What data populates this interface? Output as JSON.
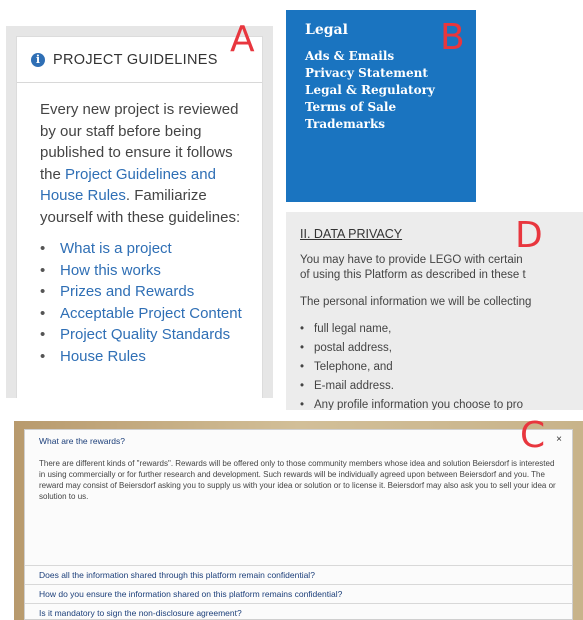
{
  "labels": {
    "a": "A",
    "b": "B",
    "c": "C",
    "d": "D"
  },
  "guidelines": {
    "title": "PROJECT GUIDELINES",
    "text_1": "Every new project is reviewed by our staff before being published to ensure it follows the ",
    "link": "Project Guidelines and House Rules",
    "text_2": ". Familiarize yourself with these guidelines:",
    "items": [
      {
        "label": "What is a project"
      },
      {
        "label": "How this works"
      },
      {
        "label": "Prizes and Rewards"
      },
      {
        "label": "Acceptable Project Content"
      },
      {
        "label": "Project Quality Standards"
      },
      {
        "label": "House Rules"
      }
    ]
  },
  "legal": {
    "title": "Legal",
    "links": [
      {
        "label": "Ads & Emails"
      },
      {
        "label": "Privacy Statement"
      },
      {
        "label": "Legal & Regulatory"
      },
      {
        "label": "Terms of Sale"
      },
      {
        "label": "Trademarks"
      }
    ]
  },
  "privacy": {
    "title": "II. DATA PRIVACY",
    "line_1": "You may have to provide LEGO with certain",
    "line_2": "of using this Platform as described in these t",
    "line_3": "The personal information we will be collecting",
    "items": [
      {
        "label": "full legal name,"
      },
      {
        "label": "postal address,"
      },
      {
        "label": "Telephone, and"
      },
      {
        "label": "E-mail address."
      },
      {
        "label": "Any profile information you choose to pro"
      }
    ]
  },
  "faq": {
    "open_question": "What are the rewards?",
    "open_answer": "There are different kinds of \"rewards\". Rewards will be offered only to those community members whose idea and solution Beiersdorf is interested in using commercially or for further research and development. Such rewards will be individually agreed upon between Beiersdorf and you. The reward may consist of Beiersdorf asking you to supply us with your idea or solution or to license it. Beiersdorf may also ask you to sell your idea or solution to us.",
    "close_label": "×",
    "questions": [
      {
        "label": "Does all the information shared through this platform remain confidential?"
      },
      {
        "label": "How do you ensure the information shared on this platform remains confidential?"
      },
      {
        "label": "Is it mandatory to sign the non-disclosure agreement?"
      }
    ]
  }
}
